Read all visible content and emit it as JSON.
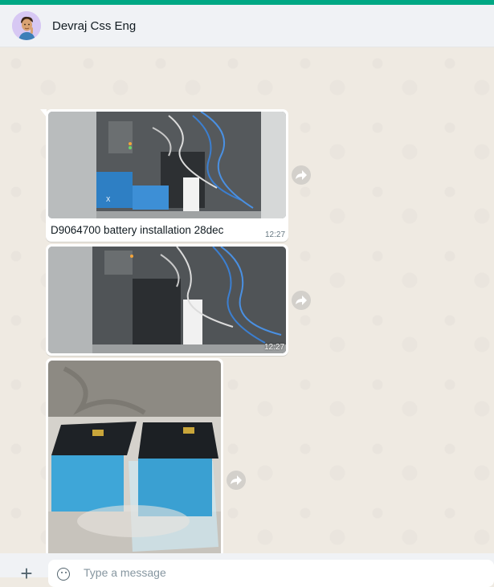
{
  "header": {
    "contact_name": "Devraj Css Eng",
    "avatar_icon": "memoji-avatar-icon"
  },
  "messages": [
    {
      "type": "image",
      "subject": "network rack with UPS and battery",
      "caption": "D9064700 battery installation 28dec",
      "time": "12:27",
      "forward_icon": "forward-arrow-icon"
    },
    {
      "type": "image",
      "subject": "network rack with UPS installed",
      "caption": "",
      "time": "12:27",
      "forward_icon": "forward-arrow-icon"
    },
    {
      "type": "image",
      "subject": "two blue batteries on a table",
      "caption": "",
      "time": "",
      "forward_icon": "forward-arrow-icon"
    }
  ],
  "composer": {
    "placeholder": "Type a message",
    "attach_icon": "plus-icon",
    "emoji_icon": "emoji-icon"
  },
  "colors": {
    "accent": "#00a884",
    "chat_background": "#efeae2",
    "header_background": "#f0f2f5"
  }
}
